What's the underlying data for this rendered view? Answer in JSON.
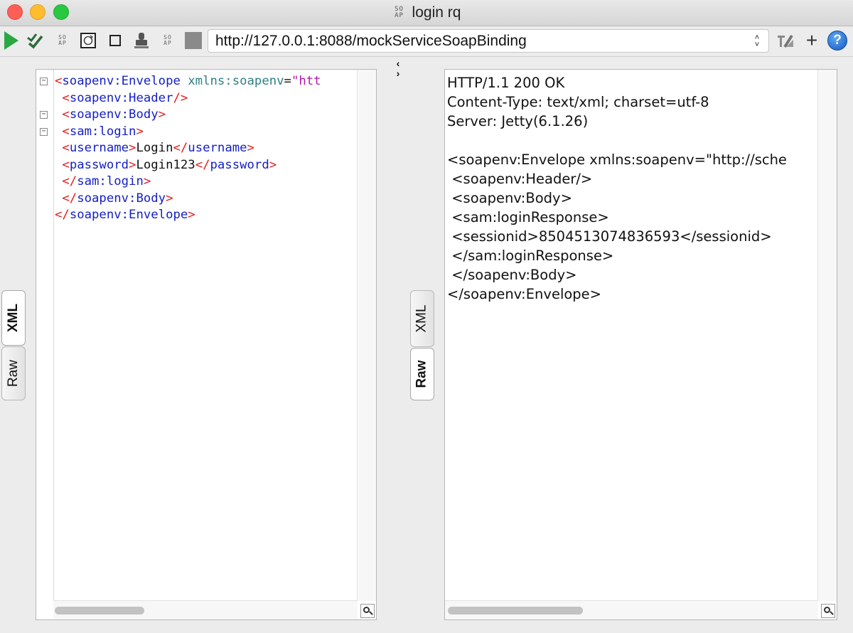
{
  "window": {
    "title": "login rq",
    "soap_glyph_top": "SO",
    "soap_glyph_bottom": "AP"
  },
  "toolbar": {
    "url": "http://127.0.0.1:8088/mockServiceSoapBinding",
    "soap_glyph_top": "SO",
    "soap_glyph_bottom": "AP",
    "help_label": "?",
    "add_label": "+"
  },
  "request_editor": {
    "tabs": [
      {
        "label": "XML",
        "active": true
      },
      {
        "label": "Raw",
        "active": false
      }
    ],
    "lines": [
      {
        "fold": true,
        "parts": [
          {
            "c": "tag",
            "t": "<"
          },
          {
            "c": "name",
            "t": "soapenv:Envelope"
          },
          {
            "c": "txt",
            "t": " "
          },
          {
            "c": "attr",
            "t": "xmlns:soapenv"
          },
          {
            "c": "txt",
            "t": "="
          },
          {
            "c": "val",
            "t": "\"htt"
          }
        ]
      },
      {
        "fold": false,
        "parts": [
          {
            "c": "txt",
            "t": " "
          },
          {
            "c": "tag",
            "t": "<"
          },
          {
            "c": "name",
            "t": "soapenv:Header"
          },
          {
            "c": "tag",
            "t": "/>"
          }
        ]
      },
      {
        "fold": true,
        "parts": [
          {
            "c": "txt",
            "t": " "
          },
          {
            "c": "tag",
            "t": "<"
          },
          {
            "c": "name",
            "t": "soapenv:Body"
          },
          {
            "c": "tag",
            "t": ">"
          }
        ]
      },
      {
        "fold": true,
        "parts": [
          {
            "c": "txt",
            "t": " "
          },
          {
            "c": "tag",
            "t": "<"
          },
          {
            "c": "name",
            "t": "sam:login"
          },
          {
            "c": "tag",
            "t": ">"
          }
        ]
      },
      {
        "fold": false,
        "parts": [
          {
            "c": "txt",
            "t": " "
          },
          {
            "c": "tag",
            "t": "<"
          },
          {
            "c": "name",
            "t": "username"
          },
          {
            "c": "tag",
            "t": ">"
          },
          {
            "c": "txt",
            "t": "Login"
          },
          {
            "c": "tag",
            "t": "</"
          },
          {
            "c": "name",
            "t": "username"
          },
          {
            "c": "tag",
            "t": ">"
          }
        ]
      },
      {
        "fold": false,
        "parts": [
          {
            "c": "txt",
            "t": " "
          },
          {
            "c": "tag",
            "t": "<"
          },
          {
            "c": "name",
            "t": "password"
          },
          {
            "c": "tag",
            "t": ">"
          },
          {
            "c": "txt",
            "t": "Login123"
          },
          {
            "c": "tag",
            "t": "</"
          },
          {
            "c": "name",
            "t": "password"
          },
          {
            "c": "tag",
            "t": ">"
          }
        ]
      },
      {
        "fold": false,
        "parts": [
          {
            "c": "txt",
            "t": " "
          },
          {
            "c": "tag",
            "t": "</"
          },
          {
            "c": "name",
            "t": "sam:login"
          },
          {
            "c": "tag",
            "t": ">"
          }
        ]
      },
      {
        "fold": false,
        "parts": [
          {
            "c": "txt",
            "t": " "
          },
          {
            "c": "tag",
            "t": "</"
          },
          {
            "c": "name",
            "t": "soapenv:Body"
          },
          {
            "c": "tag",
            "t": ">"
          }
        ]
      },
      {
        "fold": false,
        "parts": [
          {
            "c": "tag",
            "t": "</"
          },
          {
            "c": "name",
            "t": "soapenv:Envelope"
          },
          {
            "c": "tag",
            "t": ">"
          }
        ]
      }
    ]
  },
  "response_viewer": {
    "tabs": [
      {
        "label": "XML",
        "active": false
      },
      {
        "label": "Raw",
        "active": true
      }
    ],
    "lines": [
      "HTTP/1.1 200 OK",
      "Content-Type: text/xml; charset=utf-8",
      "Server: Jetty(6.1.26)",
      "",
      "<soapenv:Envelope xmlns:soapenv=\"http://sche",
      " <soapenv:Header/>",
      " <soapenv:Body>",
      " <sam:loginResponse>",
      " <sessionid>8504513074836593</sessionid>",
      " </sam:loginResponse>",
      " </soapenv:Body>",
      "</soapenv:Envelope>"
    ]
  },
  "colors": {
    "play": "#29a843",
    "xml_tag": "#e8191b",
    "xml_name": "#1520c8",
    "xml_attr": "#2f7f86",
    "xml_value": "#b617a8"
  }
}
